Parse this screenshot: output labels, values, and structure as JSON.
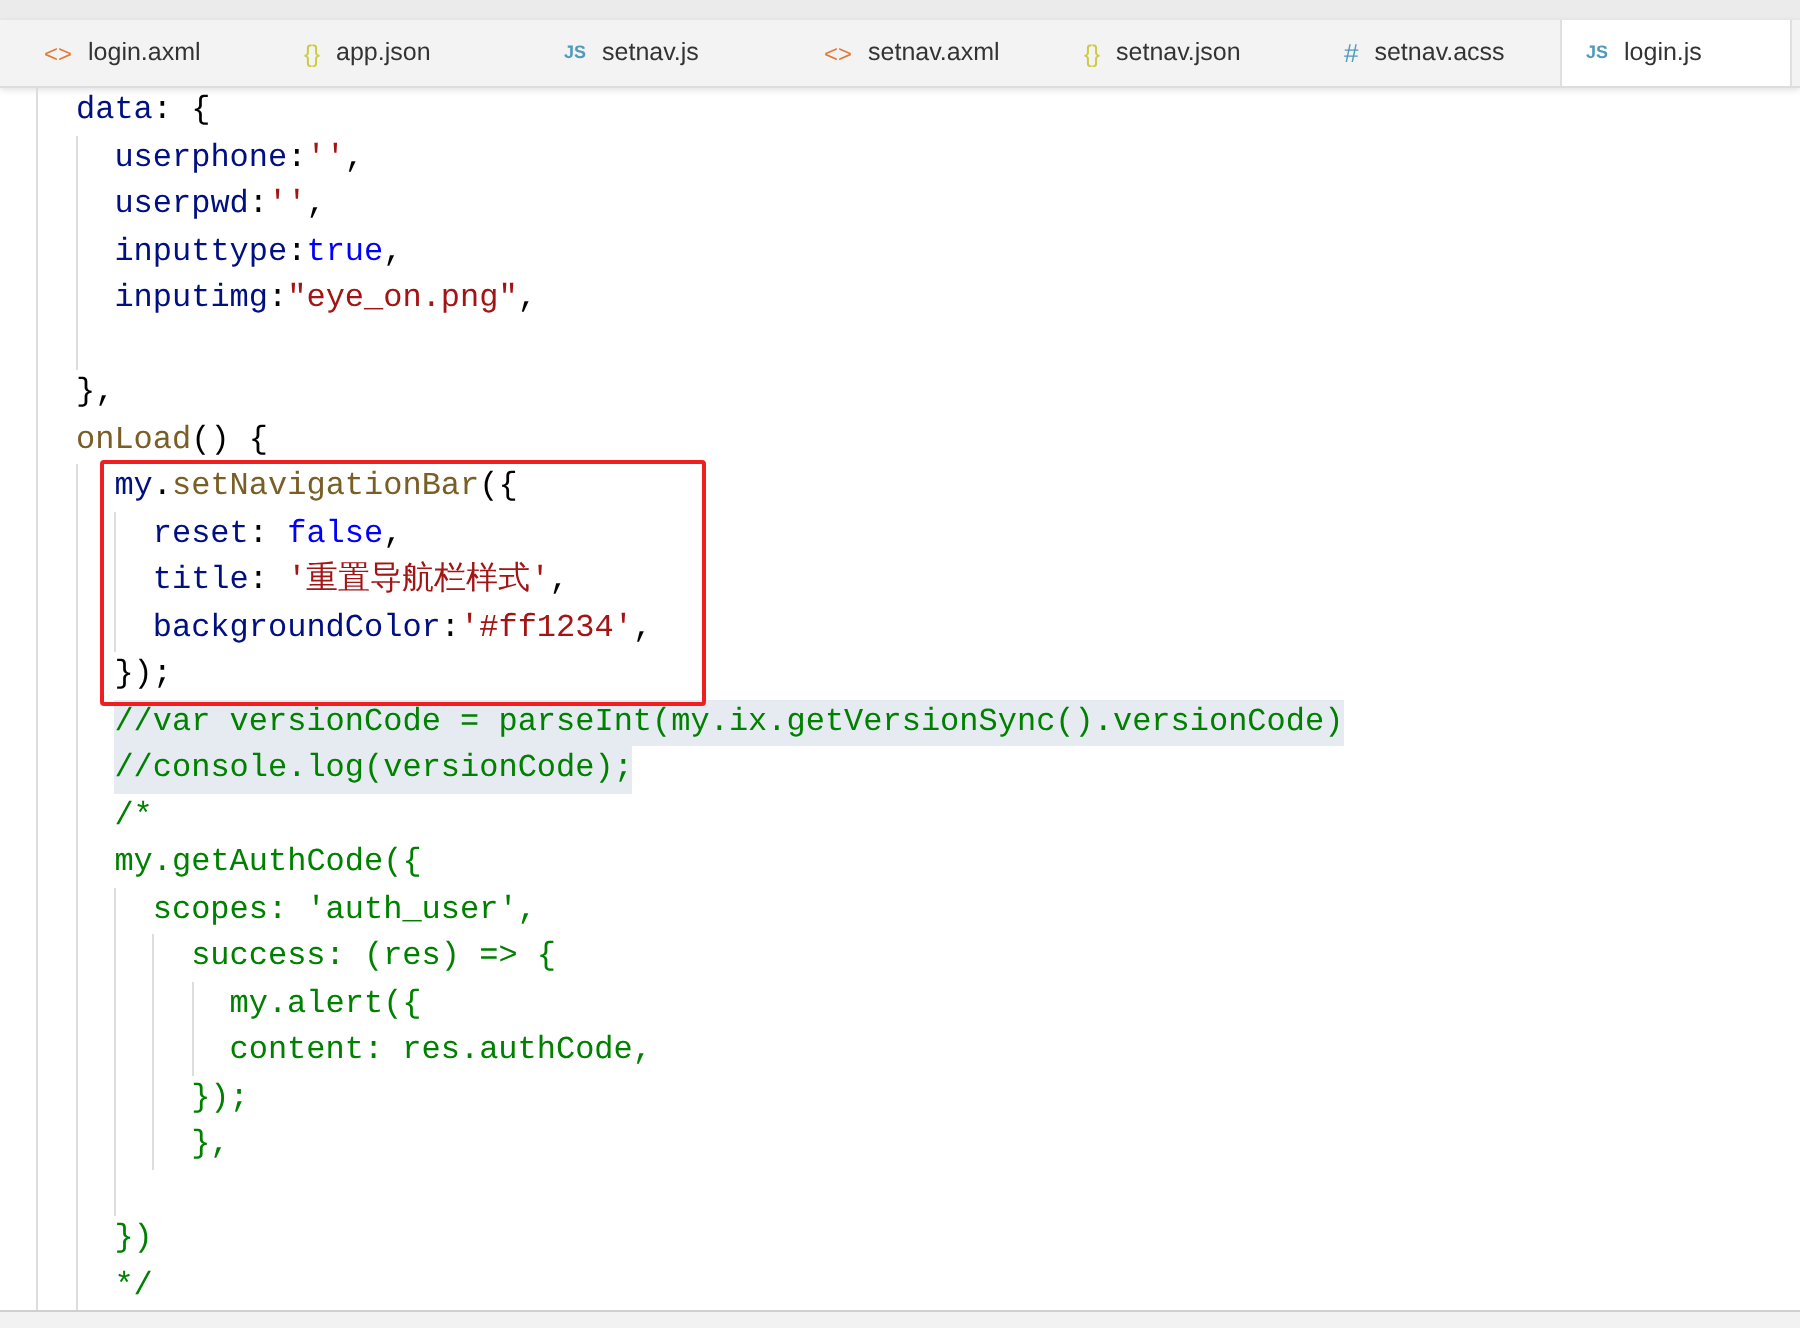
{
  "tabs": [
    {
      "label": "login.axml",
      "kind": "xml",
      "icon": "<>",
      "selected": false
    },
    {
      "label": "app.json",
      "kind": "json",
      "icon": "{}",
      "selected": false
    },
    {
      "label": "setnav.js",
      "kind": "js",
      "icon": "JS",
      "selected": false
    },
    {
      "label": "setnav.axml",
      "kind": "xml",
      "icon": "<>",
      "selected": false
    },
    {
      "label": "setnav.json",
      "kind": "json",
      "icon": "{}",
      "selected": false
    },
    {
      "label": "setnav.acss",
      "kind": "css",
      "icon": "#",
      "selected": false
    },
    {
      "label": "login.js",
      "kind": "js",
      "icon": "JS",
      "selected": true
    }
  ],
  "code": [
    {
      "kind": "line",
      "tokens": [
        {
          "kind": "name",
          "text": "data"
        },
        {
          "kind": "plain",
          "text": ": {"
        }
      ],
      "children": [
        {
          "kind": "line",
          "tokens": [
            {
              "kind": "name",
              "text": "userphone"
            },
            {
              "kind": "plain",
              "text": ":"
            },
            {
              "kind": "string",
              "text": "''"
            },
            {
              "kind": "plain",
              "text": ","
            }
          ]
        },
        {
          "kind": "line",
          "tokens": [
            {
              "kind": "name",
              "text": "userpwd"
            },
            {
              "kind": "plain",
              "text": ":"
            },
            {
              "kind": "string",
              "text": "''"
            },
            {
              "kind": "plain",
              "text": ","
            }
          ]
        },
        {
          "kind": "line",
          "tokens": [
            {
              "kind": "name",
              "text": "inputtype"
            },
            {
              "kind": "plain",
              "text": ":"
            },
            {
              "kind": "keyword",
              "text": "true"
            },
            {
              "kind": "plain",
              "text": ","
            }
          ]
        },
        {
          "kind": "line",
          "tokens": [
            {
              "kind": "name",
              "text": "inputimg"
            },
            {
              "kind": "plain",
              "text": ":"
            },
            {
              "kind": "string",
              "text": "\"eye_on.png\""
            },
            {
              "kind": "plain",
              "text": ","
            }
          ]
        },
        {
          "kind": "blank"
        }
      ]
    },
    {
      "kind": "line",
      "tokens": [
        {
          "kind": "plain",
          "text": "},"
        }
      ]
    },
    {
      "kind": "line",
      "tokens": [
        {
          "kind": "func",
          "text": "onLoad"
        },
        {
          "kind": "plain",
          "text": "() {"
        }
      ],
      "children": [
        {
          "kind": "highlight_box",
          "children": [
            {
              "kind": "line",
              "tokens": [
                {
                  "kind": "name",
                  "text": "my"
                },
                {
                  "kind": "plain",
                  "text": "."
                },
                {
                  "kind": "func",
                  "text": "setNavigationBar"
                },
                {
                  "kind": "plain",
                  "text": "({"
                }
              ],
              "children": [
                {
                  "kind": "line",
                  "tokens": [
                    {
                      "kind": "name",
                      "text": "reset"
                    },
                    {
                      "kind": "plain",
                      "text": ": "
                    },
                    {
                      "kind": "keyword",
                      "text": "false"
                    },
                    {
                      "kind": "plain",
                      "text": ","
                    }
                  ]
                },
                {
                  "kind": "line",
                  "tokens": [
                    {
                      "kind": "name",
                      "text": "title"
                    },
                    {
                      "kind": "plain",
                      "text": ": "
                    },
                    {
                      "kind": "string",
                      "text": "'重置导航栏样式'"
                    },
                    {
                      "kind": "plain",
                      "text": ","
                    }
                  ]
                },
                {
                  "kind": "line",
                  "tokens": [
                    {
                      "kind": "name",
                      "text": "backgroundColor"
                    },
                    {
                      "kind": "plain",
                      "text": ":"
                    },
                    {
                      "kind": "string",
                      "text": "'#ff1234'"
                    },
                    {
                      "kind": "plain",
                      "text": ","
                    }
                  ]
                }
              ]
            },
            {
              "kind": "line",
              "tokens": [
                {
                  "kind": "plain",
                  "text": "});"
                }
              ]
            }
          ]
        },
        {
          "kind": "line",
          "highlighted": true,
          "tokens": [
            {
              "kind": "comment",
              "text": "//var versionCode = parseInt(my.ix.getVersionSync().versionCode)"
            }
          ]
        },
        {
          "kind": "line",
          "highlighted": true,
          "tokens": [
            {
              "kind": "comment",
              "text": "//console.log(versionCode);"
            }
          ]
        },
        {
          "kind": "line",
          "tokens": [
            {
              "kind": "comment",
              "text": "/*"
            }
          ]
        },
        {
          "kind": "line",
          "tokens": [
            {
              "kind": "comment",
              "text": "my.getAuthCode({"
            }
          ],
          "children": [
            {
              "kind": "line",
              "tokens": [
                {
                  "kind": "comment",
                  "text": "scopes: 'auth_user',"
                }
              ],
              "children": [
                {
                  "kind": "line",
                  "tokens": [
                    {
                      "kind": "comment",
                      "text": "success: (res) => {"
                    }
                  ],
                  "children": [
                    {
                      "kind": "line",
                      "tokens": [
                        {
                          "kind": "comment",
                          "text": "my.alert({"
                        }
                      ]
                    },
                    {
                      "kind": "line",
                      "tokens": [
                        {
                          "kind": "comment",
                          "text": "content: res.authCode,"
                        }
                      ]
                    }
                  ]
                },
                {
                  "kind": "line",
                  "tokens": [
                    {
                      "kind": "comment",
                      "text": "});"
                    }
                  ]
                },
                {
                  "kind": "line",
                  "tokens": [
                    {
                      "kind": "comment",
                      "text": "},"
                    }
                  ]
                }
              ]
            },
            {
              "kind": "blank"
            }
          ]
        },
        {
          "kind": "line",
          "tokens": [
            {
              "kind": "comment",
              "text": "})"
            }
          ]
        },
        {
          "kind": "line",
          "tokens": [
            {
              "kind": "comment",
              "text": "*/"
            }
          ]
        }
      ]
    }
  ]
}
